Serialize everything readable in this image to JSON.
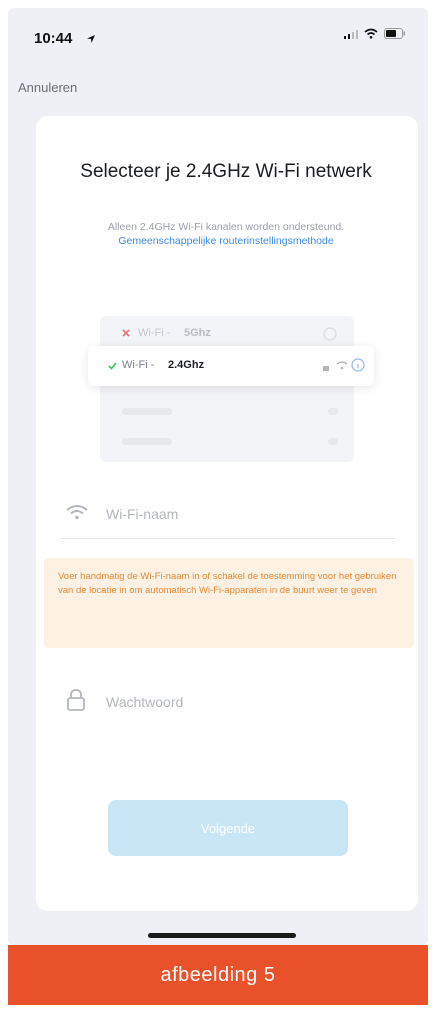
{
  "status_bar": {
    "time": "10:44"
  },
  "nav": {
    "cancel_label": "Annuleren"
  },
  "card": {
    "title": "Selecteer je 2.4GHz Wi-Fi netwerk",
    "description": "Alleen 2.4GHz Wi-Fi kanalen worden ondersteund.",
    "link_text": "Gemeenschappelijke routerinstellingsmethode"
  },
  "network_list": {
    "row_5g": {
      "prefix": "Wi-Fi -",
      "band": "5Ghz"
    },
    "row_24g": {
      "prefix": "Wi-Fi -",
      "band": "2.4Ghz"
    }
  },
  "wifi_field": {
    "placeholder": "Wi-Fi-naam"
  },
  "warning": {
    "text": "Voer handmatig de Wi-Fi-naam in of schakel de toestemming voor het gebruiken van de locatie in om automatisch Wi-Fi-apparaten in de buurt weer te geven"
  },
  "password_field": {
    "placeholder": "Wachtwoord"
  },
  "next_button": {
    "label": "Volgende"
  },
  "caption": {
    "text": "afbeelding 5"
  },
  "colors": {
    "accent": "#3d8ae8",
    "warning": "#e98a36",
    "caption_bg": "#e9512a",
    "button_disabled": "#c9e6f7"
  }
}
